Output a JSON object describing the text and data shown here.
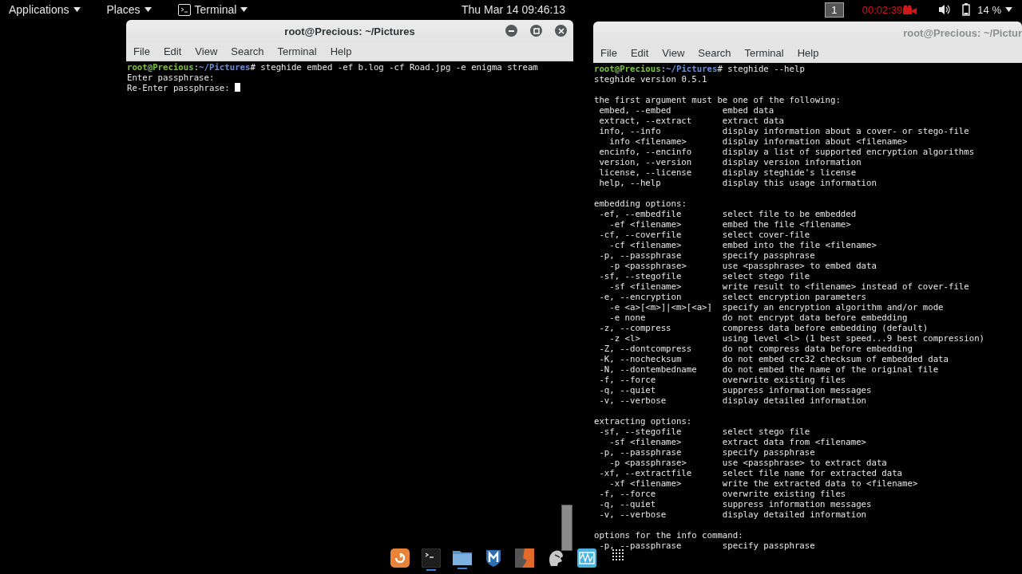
{
  "top_bar": {
    "menus": [
      {
        "label": "Applications",
        "icon": false
      },
      {
        "label": "Places",
        "icon": false
      },
      {
        "label": "Terminal",
        "icon": true
      }
    ],
    "clock": "Thu Mar 14  09:46:13",
    "workspace": "1",
    "recording_time": "00:02:39",
    "battery": "14 %"
  },
  "left_terminal": {
    "title": "root@Precious: ~/Pictures",
    "active": true,
    "menu": [
      "File",
      "Edit",
      "View",
      "Search",
      "Terminal",
      "Help"
    ],
    "prompt": {
      "user_host": "root@Precious",
      "separator": ":",
      "path": "~/Pictures",
      "symbol": "#",
      "command": "steghide embed -ef b.log -cf Road.jpg -e enigma stream"
    },
    "output": [
      "Enter passphrase:",
      "Re-Enter passphrase: "
    ]
  },
  "right_terminal": {
    "title": "root@Precious: ~/Pictur",
    "active": false,
    "menu": [
      "File",
      "Edit",
      "View",
      "Search",
      "Terminal",
      "Help"
    ],
    "prompt": {
      "user_host": "root@Precious",
      "separator": ":",
      "path": "~/Pictures",
      "symbol": "#",
      "command": "steghide --help"
    },
    "output": [
      "steghide version 0.5.1"
    ],
    "sections": [
      {
        "heading": "the first argument must be one of the following:",
        "rows": [
          {
            "option": "embed, --embed",
            "description": "embed data"
          },
          {
            "option": "extract, --extract",
            "description": "extract data"
          },
          {
            "option": "info, --info",
            "description": "display information about a cover- or stego-file",
            "children": [
              {
                "option": "info <filename>",
                "description": "display information about <filename>"
              }
            ]
          },
          {
            "option": "encinfo, --encinfo",
            "description": "display a list of supported encryption algorithms"
          },
          {
            "option": "version, --version",
            "description": "display version information"
          },
          {
            "option": "license, --license",
            "description": "display steghide's license"
          },
          {
            "option": "help, --help",
            "description": "display this usage information"
          }
        ]
      },
      {
        "heading": "embedding options:",
        "rows": [
          {
            "option": "-ef, --embedfile",
            "description": "select file to be embedded",
            "children": [
              {
                "option": "-ef <filename>",
                "description": "embed the file <filename>"
              }
            ]
          },
          {
            "option": "-cf, --coverfile",
            "description": "select cover-file",
            "children": [
              {
                "option": "-cf <filename>",
                "description": "embed into the file <filename>"
              }
            ]
          },
          {
            "option": "-p, --passphrase",
            "description": "specify passphrase",
            "children": [
              {
                "option": "-p <passphrase>",
                "description": "use <passphrase> to embed data"
              }
            ]
          },
          {
            "option": "-sf, --stegofile",
            "description": "select stego file",
            "children": [
              {
                "option": "-sf <filename>",
                "description": "write result to <filename> instead of cover-file"
              }
            ]
          },
          {
            "option": "-e, --encryption",
            "description": "select encryption parameters",
            "children": [
              {
                "option": "-e <a>[<m>]|<m>[<a>]",
                "description": "specify an encryption algorithm and/or mode"
              },
              {
                "option": "-e none",
                "description": "do not encrypt data before embedding"
              }
            ]
          },
          {
            "option": "-z, --compress",
            "description": "compress data before embedding (default)",
            "children": [
              {
                "option": "-z <l>",
                "description": "using level <l> (1 best speed...9 best compression)"
              }
            ]
          },
          {
            "option": "-Z, --dontcompress",
            "description": "do not compress data before embedding"
          },
          {
            "option": "-K, --nochecksum",
            "description": "do not embed crc32 checksum of embedded data"
          },
          {
            "option": "-N, --dontembedname",
            "description": "do not embed the name of the original file"
          },
          {
            "option": "-f, --force",
            "description": "overwrite existing files"
          },
          {
            "option": "-q, --quiet",
            "description": "suppress information messages"
          },
          {
            "option": "-v, --verbose",
            "description": "display detailed information"
          }
        ]
      },
      {
        "heading": "extracting options:",
        "rows": [
          {
            "option": "-sf, --stegofile",
            "description": "select stego file",
            "children": [
              {
                "option": "-sf <filename>",
                "description": "extract data from <filename>"
              }
            ]
          },
          {
            "option": "-p, --passphrase",
            "description": "specify passphrase",
            "children": [
              {
                "option": "-p <passphrase>",
                "description": "use <passphrase> to extract data"
              }
            ]
          },
          {
            "option": "-xf, --extractfile",
            "description": "select file name for extracted data",
            "children": [
              {
                "option": "-xf <filename>",
                "description": "write the extracted data to <filename>"
              }
            ]
          },
          {
            "option": "-f, --force",
            "description": "overwrite existing files"
          },
          {
            "option": "-q, --quiet",
            "description": "suppress information messages"
          },
          {
            "option": "-v, --verbose",
            "description": "display detailed information"
          }
        ]
      },
      {
        "heading": "options for the info command:",
        "rows": [
          {
            "option": "-p, --passphrase",
            "description": "specify passphrase"
          }
        ]
      }
    ]
  },
  "dock": [
    {
      "kind": "browser",
      "running": false
    },
    {
      "kind": "terminal",
      "running": true
    },
    {
      "kind": "folder",
      "running": true
    },
    {
      "kind": "shield",
      "running": false
    },
    {
      "kind": "bolt",
      "running": false
    },
    {
      "kind": "head",
      "running": false
    },
    {
      "kind": "wave",
      "running": false
    },
    {
      "kind": "grid",
      "running": false
    }
  ]
}
